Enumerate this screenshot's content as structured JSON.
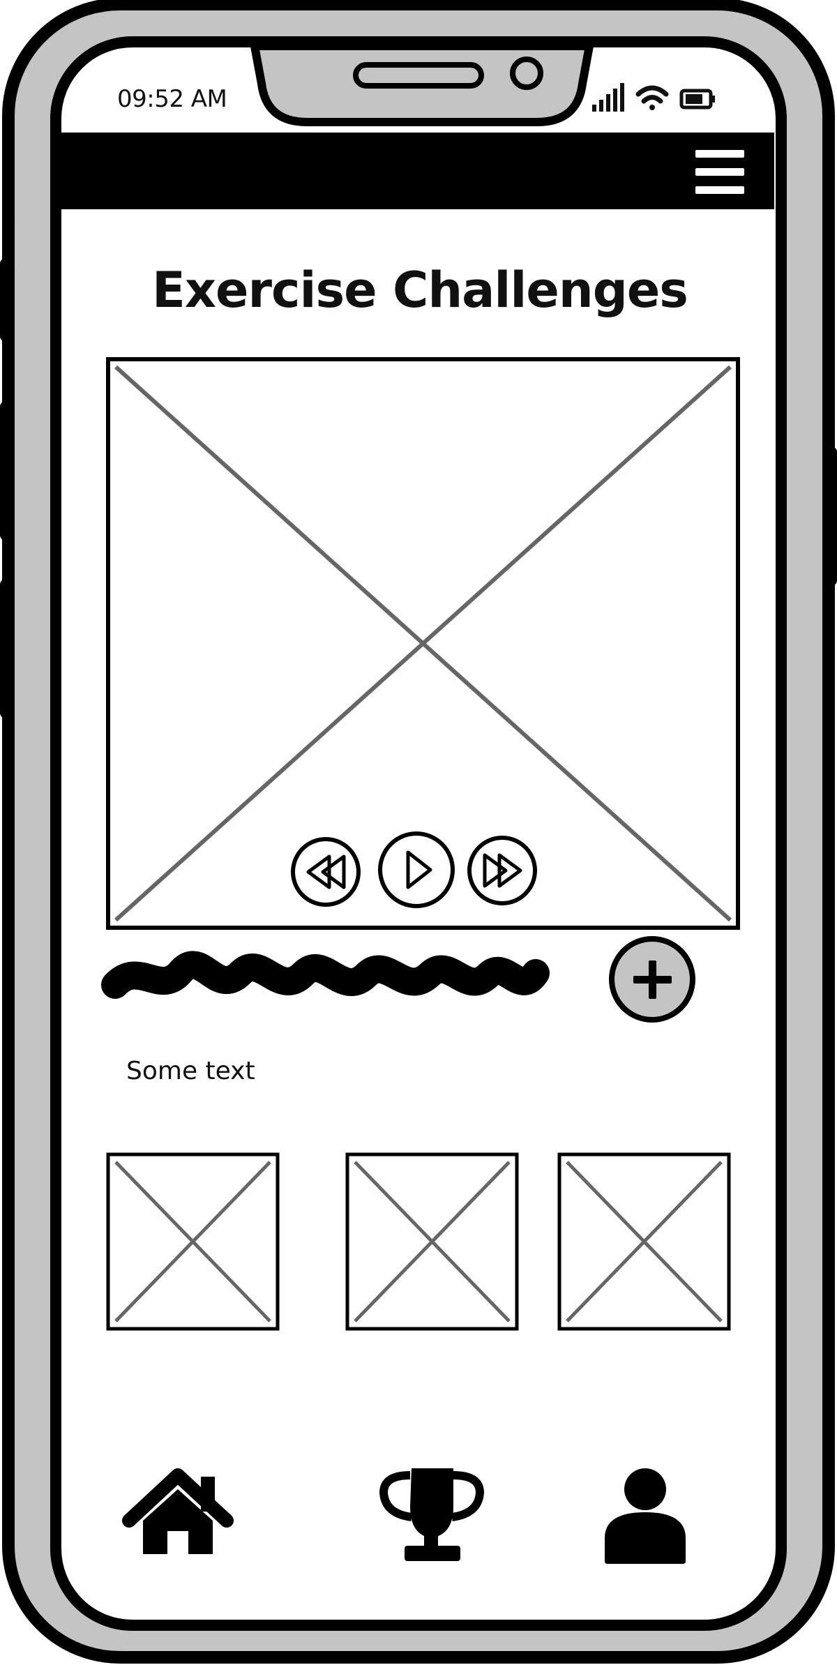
{
  "status_bar": {
    "time": "09:52 AM",
    "signal_icon": "signal-bars-icon",
    "wifi_icon": "wifi-icon",
    "battery_icon": "battery-icon"
  },
  "top_bar": {
    "menu_icon": "hamburger-menu-icon"
  },
  "main": {
    "title": "Exercise Challenges",
    "video": {
      "controls": [
        "rewind-icon",
        "play-icon",
        "fast-forward-icon"
      ]
    },
    "add_icon": "plus-circle-icon",
    "body_text": "Some text",
    "thumbnail_count": 3
  },
  "bottom_nav": {
    "items": [
      "home-icon",
      "trophy-icon",
      "user-icon"
    ]
  },
  "colors": {
    "frame_fill": "#c4c4c4",
    "outline": "#000000",
    "placeholder_line": "#666666",
    "screen": "#ffffff"
  }
}
